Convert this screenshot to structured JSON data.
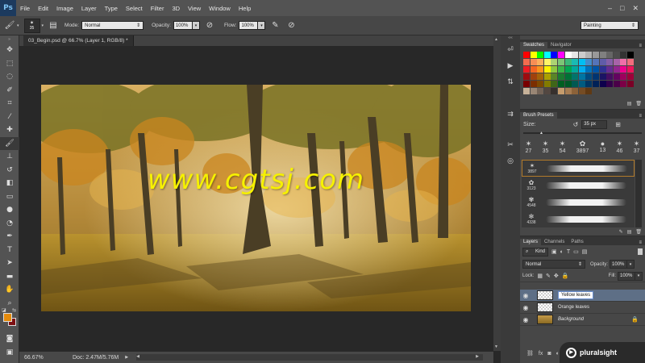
{
  "app": {
    "logo": "Ps"
  },
  "menu": [
    "File",
    "Edit",
    "Image",
    "Layer",
    "Type",
    "Select",
    "Filter",
    "3D",
    "View",
    "Window",
    "Help"
  ],
  "window_controls": [
    "–",
    "□",
    "✕"
  ],
  "options": {
    "brush_size": "35",
    "mode_label": "Mode:",
    "mode_value": "Normal",
    "opacity_label": "Opacity:",
    "opacity_value": "100%",
    "flow_label": "Flow:",
    "flow_value": "100%",
    "workspace": "Painting"
  },
  "document": {
    "tab_title": "03_Begin.psd @ 66.7% (Layer 1, RGB/8) *",
    "watermark": "www.cgtsj.com"
  },
  "status": {
    "zoom": "66.67%",
    "doc_info": "Doc: 2.47M/5.76M"
  },
  "swatches_panel": {
    "tabs": [
      "Swatches",
      "Navigator"
    ]
  },
  "brush_presets": {
    "title": "Brush Presets",
    "size_label": "Size:",
    "size_value": "35 px",
    "tips": [
      "27",
      "35",
      "54",
      "3897",
      "13",
      "46",
      "37"
    ],
    "list": [
      "3897",
      "3123",
      "4548",
      "4338"
    ]
  },
  "layers_panel": {
    "tabs": [
      "Layers",
      "Channels",
      "Paths"
    ],
    "filter_kind": "Kind",
    "blend_mode": "Normal",
    "opacity_label": "Opacity:",
    "opacity_value": "100%",
    "lock_label": "Lock:",
    "fill_label": "Fill:",
    "fill_value": "100%",
    "layers": [
      {
        "name": "Yellow leaves",
        "selected": true,
        "editing": true
      },
      {
        "name": "Orange leaves",
        "selected": false
      },
      {
        "name": "Background",
        "selected": false,
        "locked": true
      }
    ]
  },
  "watermark_brand": "pluralsight",
  "colors": {
    "foreground": "#e38a0c",
    "background": "#7c0f12",
    "accent_selected_layer": "#5e6f86"
  }
}
